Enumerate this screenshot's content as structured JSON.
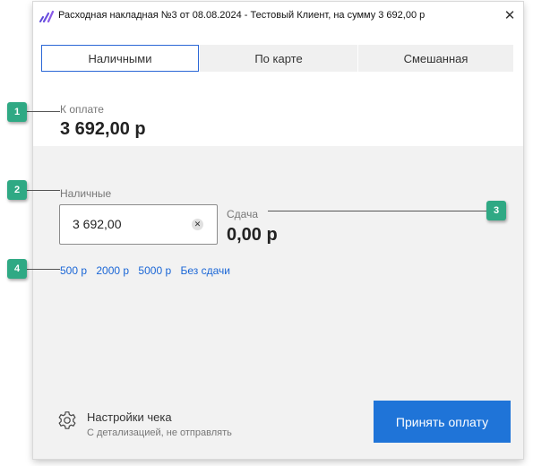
{
  "window": {
    "title": "Расходная накладная №3 от 08.08.2024 - Тестовый Клиент, на сумму 3 692,00 р",
    "close_glyph": "✕"
  },
  "tabs": [
    {
      "label": "Наличными",
      "selected": true
    },
    {
      "label": "По карте",
      "selected": false
    },
    {
      "label": "Смешанная",
      "selected": false
    }
  ],
  "payment": {
    "label": "К оплате",
    "amount": "3 692,00 р"
  },
  "cash": {
    "label": "Наличные",
    "value": "3 692,00"
  },
  "change": {
    "label": "Сдача",
    "amount": "0,00 р"
  },
  "quick_amounts": [
    "500 р",
    "2000 р",
    "5000 р",
    "Без сдачи"
  ],
  "receipt_settings": {
    "title": "Настройки чека",
    "subtitle": "С детализацией, не отправлять"
  },
  "accept_button": {
    "label": "Принять оплату"
  },
  "callouts": [
    "1",
    "2",
    "3",
    "4"
  ],
  "colors": {
    "accent": "#1f74d8",
    "callout": "#2fa984",
    "selected_tab_border": "#2b67d6"
  },
  "icons": {
    "logo": "app-logo-icon",
    "settings": "gear-icon",
    "clear": "clear-icon",
    "close": "close-icon"
  }
}
